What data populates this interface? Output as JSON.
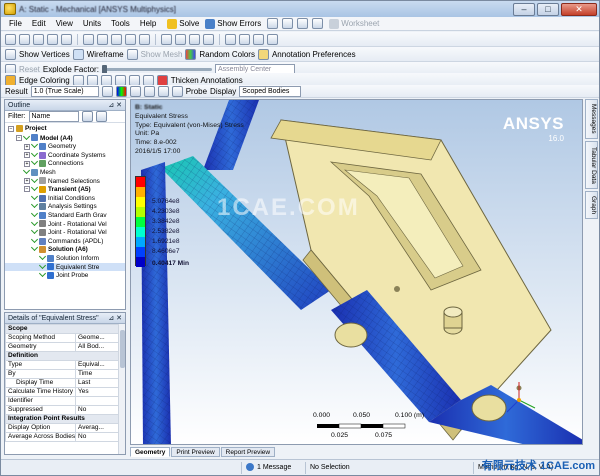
{
  "window": {
    "title": "A: Static - Mechanical [ANSYS Multiphysics]"
  },
  "menu": {
    "items": [
      "File",
      "Edit",
      "View",
      "Units",
      "Tools",
      "Help"
    ],
    "solve_label": "Solve",
    "show_errors_label": "Show Errors",
    "worksheet_label": "Worksheet"
  },
  "toolbar2": {
    "show_vertices": "Show Vertices",
    "wireframe": "Wireframe",
    "show_mesh": "Show Mesh",
    "random_colors": "Random Colors",
    "annotation_prefs": "Annotation Preferences"
  },
  "toolbar3": {
    "reset": "Reset",
    "explode_factor": "Explode Factor:",
    "assembly_center": "Assembly Center"
  },
  "toolbar4": {
    "edge_coloring": "Edge Coloring",
    "thicken_annotations": "Thicken Annotations"
  },
  "toolbar5": {
    "result_label": "Result",
    "result_scale": "1.0 (True Scale)",
    "probe_label": "Probe",
    "display_label": "Display",
    "display_value": "Scoped Bodies"
  },
  "outline": {
    "title": "Outline",
    "filter_label": "Filter:",
    "filter_value": "Name",
    "items": [
      {
        "label": "Project",
        "level": 0,
        "bold": true
      },
      {
        "label": "Model (A4)",
        "level": 1,
        "bold": true
      },
      {
        "label": "Geometry",
        "level": 2
      },
      {
        "label": "Coordinate Systems",
        "level": 2
      },
      {
        "label": "Connections",
        "level": 2
      },
      {
        "label": "Mesh",
        "level": 2
      },
      {
        "label": "Named Selections",
        "level": 2
      },
      {
        "label": "Transient (A5)",
        "level": 2,
        "bold": true
      },
      {
        "label": "Initial Conditions",
        "level": 3
      },
      {
        "label": "Analysis Settings",
        "level": 3
      },
      {
        "label": "Standard Earth Grav",
        "level": 3
      },
      {
        "label": "Joint - Rotational Vel",
        "level": 3
      },
      {
        "label": "Joint - Rotational Vel",
        "level": 3
      },
      {
        "label": "Commands (APDL)",
        "level": 3
      },
      {
        "label": "Solution (A6)",
        "level": 3,
        "bold": true
      },
      {
        "label": "Solution Inform",
        "level": 4
      },
      {
        "label": "Equivalent Stre",
        "level": 4
      },
      {
        "label": "Joint Probe",
        "level": 4
      }
    ]
  },
  "details": {
    "title": "Details of \"Equivalent Stress\"",
    "rows": [
      {
        "section": "Scope"
      },
      {
        "k": "Scoping Method",
        "v": "Geome..."
      },
      {
        "k": "Geometry",
        "v": "All Bod..."
      },
      {
        "section": "Definition"
      },
      {
        "k": "Type",
        "v": "Equival..."
      },
      {
        "k": "By",
        "v": "Time"
      },
      {
        "k": "Display Time",
        "v": "Last",
        "indent": true
      },
      {
        "k": "Calculate Time History",
        "v": "Yes"
      },
      {
        "k": "Identifier",
        "v": ""
      },
      {
        "k": "Suppressed",
        "v": "No"
      },
      {
        "section": "Integration Point Results"
      },
      {
        "k": "Display Option",
        "v": "Averag..."
      },
      {
        "k": "Average Across Bodies",
        "v": "No"
      }
    ]
  },
  "viewport": {
    "legend_title": "B: Static",
    "legend_lines": [
      "Equivalent Stress",
      "Type: Equivalent (von-Mises) Stress",
      "Unit: Pa",
      "Time: 8.e-002",
      "2016/1/5 17:00"
    ],
    "color_labels": [
      "5.0764e8",
      "4.2303e8",
      "3.3842e8",
      "2.5382e8",
      "1.6921e8",
      "8.4606e7",
      "0.40417 Min"
    ],
    "brand": "ANSYS",
    "version": "16.0",
    "watermark": "1CAE.COM",
    "scale_top": [
      "0.000",
      "0.050",
      "0.100 (m)"
    ],
    "scale_bottom": [
      "0.025",
      "0.075"
    ]
  },
  "side_tabs": [
    "Messages",
    "Tabular Data",
    "Graph"
  ],
  "bottom_tabs": [
    "Geometry",
    "Print Preview",
    "Report Preview"
  ],
  "status": {
    "messages": "1 Message",
    "selection": "No Selection",
    "units": "Metric (m, kg, N, s, V, A)"
  },
  "corner_watermark": "有限元技术 1CAE.com",
  "colors": {
    "accent": "#1a5fb4",
    "chrome": "#eef2f7"
  }
}
